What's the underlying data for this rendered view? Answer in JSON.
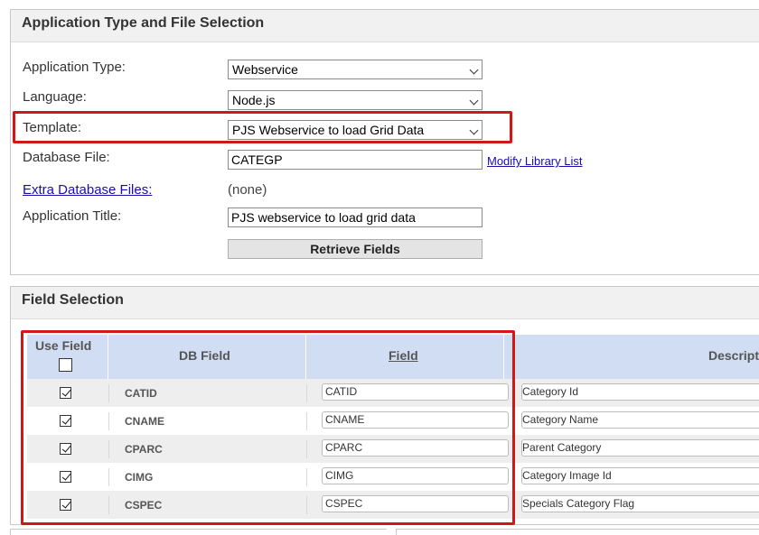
{
  "section1": {
    "title": "Application Type and File Selection",
    "app_type_label": "Application Type:",
    "app_type_value": "Webservice",
    "language_label": "Language:",
    "language_value": "Node.js",
    "template_label": "Template:",
    "template_value": "PJS Webservice to load Grid Data",
    "db_file_label": "Database File:",
    "db_file_value": "CATEGP",
    "modify_link": "Modify Library List",
    "extra_files_link": "Extra Database Files:",
    "extra_files_value": "(none)",
    "app_title_label": "Application Title:",
    "app_title_value": "PJS webservice to load grid data",
    "retrieve_button": "Retrieve Fields"
  },
  "section2": {
    "title": "Field Selection",
    "columns": {
      "use": "Use Field",
      "db": "DB Field",
      "field": "Field",
      "desc": "Descript"
    },
    "rows": [
      {
        "checked": true,
        "db": "CATID",
        "field": "CATID",
        "desc": "Category Id"
      },
      {
        "checked": true,
        "db": "CNAME",
        "field": "CNAME",
        "desc": "Category Name"
      },
      {
        "checked": true,
        "db": "CPARC",
        "field": "CPARC",
        "desc": "Parent Category"
      },
      {
        "checked": true,
        "db": "CIMG",
        "field": "CIMG",
        "desc": "Category Image Id"
      },
      {
        "checked": true,
        "db": "CSPEC",
        "field": "CSPEC",
        "desc": "Specials Category Flag"
      }
    ]
  },
  "colors": {
    "highlight": "#d01818",
    "table_header": "#d1ddf3",
    "link": "#1a0dab"
  }
}
